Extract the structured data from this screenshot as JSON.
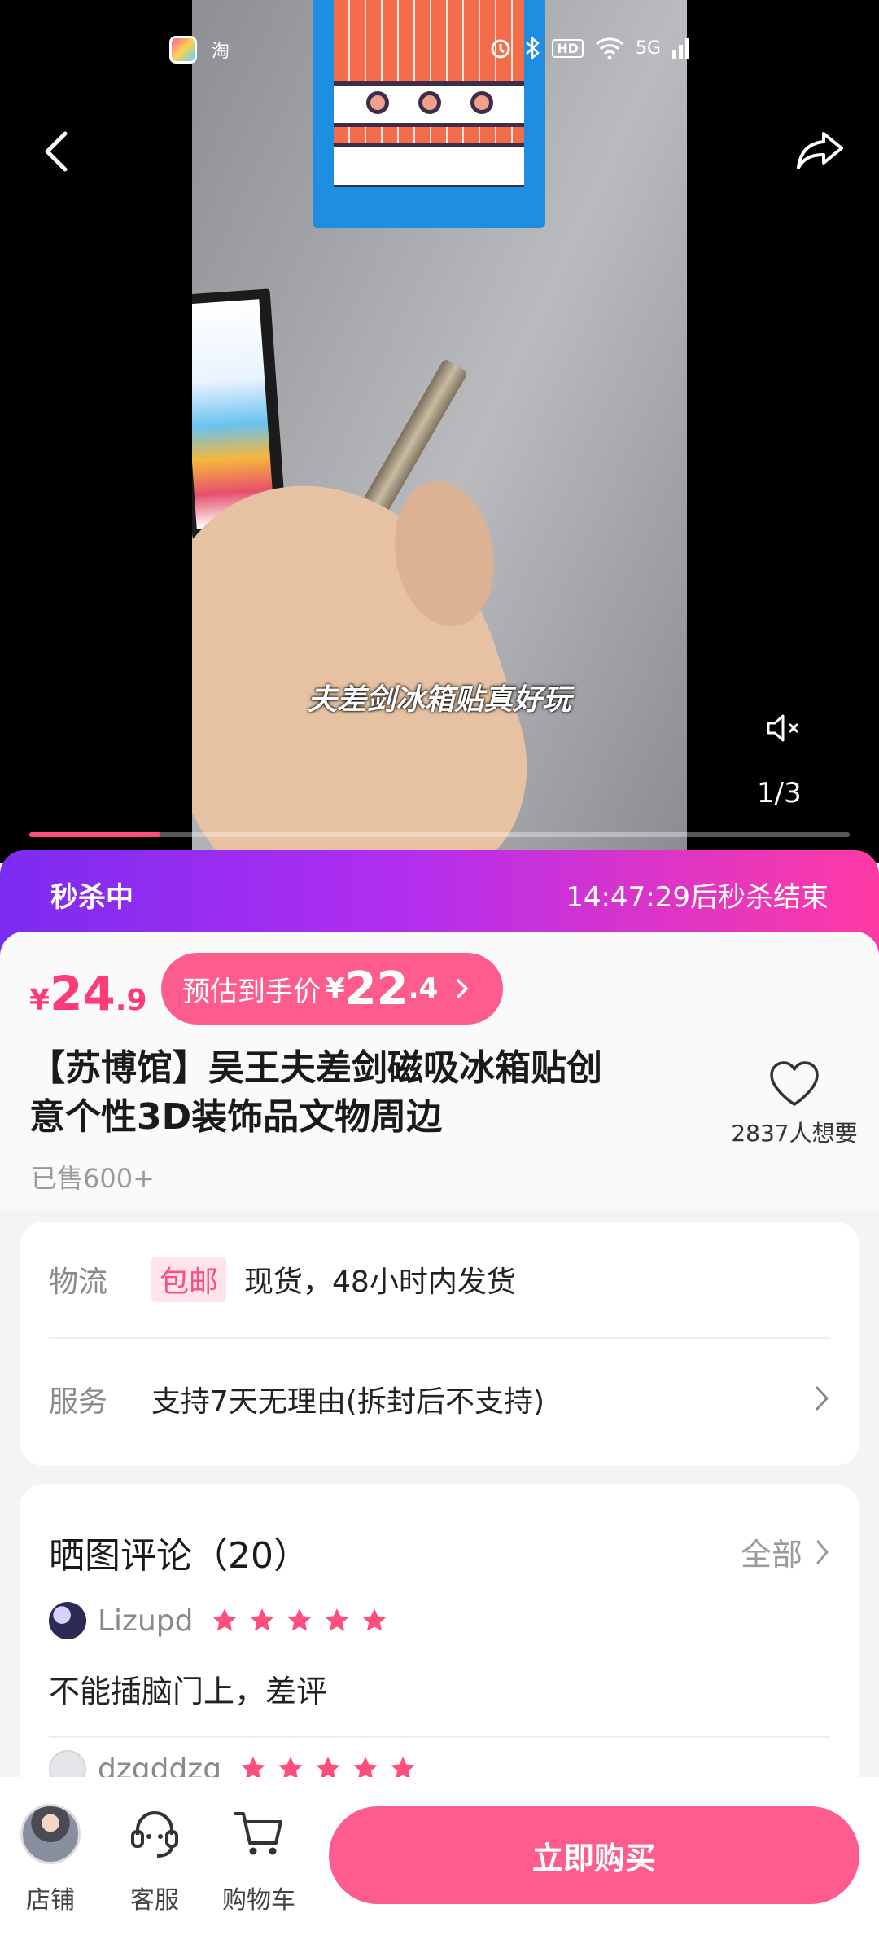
{
  "status_bar": {
    "app_label": "淘",
    "network": "5G",
    "hd_badge": "HD"
  },
  "video": {
    "caption": "夫差剑冰箱贴真好玩",
    "pager": "1/3",
    "progress_fraction": 0.16
  },
  "flash_sale": {
    "label": "秒杀中",
    "countdown": "14:47:29后秒杀结束"
  },
  "product": {
    "price_currency": "¥",
    "price_int": "24",
    "price_dec": ".9",
    "estimate_label": "预估到手价",
    "estimate_currency": "¥",
    "estimate_int": "22",
    "estimate_dec": ".4",
    "title_line1": "【苏博馆】吴王夫差剑磁吸冰箱贴创",
    "title_line2": "意个性3D装饰品文物周边",
    "sold": "已售600+",
    "want_count": "2837人想要"
  },
  "service": {
    "logistics_key": "物流",
    "logistics_tag": "包邮",
    "logistics_value": "现货，48小时内发货",
    "service_key": "服务",
    "service_value": "支持7天无理由(拆封后不支持)"
  },
  "reviews": {
    "title": "晒图评论（20）",
    "all_label": "全部",
    "items": [
      {
        "user": "Lizupd",
        "stars": 5,
        "text": "不能插脑门上，差评"
      },
      {
        "user": "dzqddzq",
        "stars": 5,
        "text": ""
      }
    ]
  },
  "bottom_bar": {
    "store_label": "店铺",
    "service_label": "客服",
    "cart_label": "购物车",
    "buy_label": "立即购买"
  },
  "colors": {
    "accent": "#ff5c8e",
    "price": "#ff3b77",
    "flash_start": "#7b2cf0",
    "flash_end": "#ff3aa5"
  }
}
